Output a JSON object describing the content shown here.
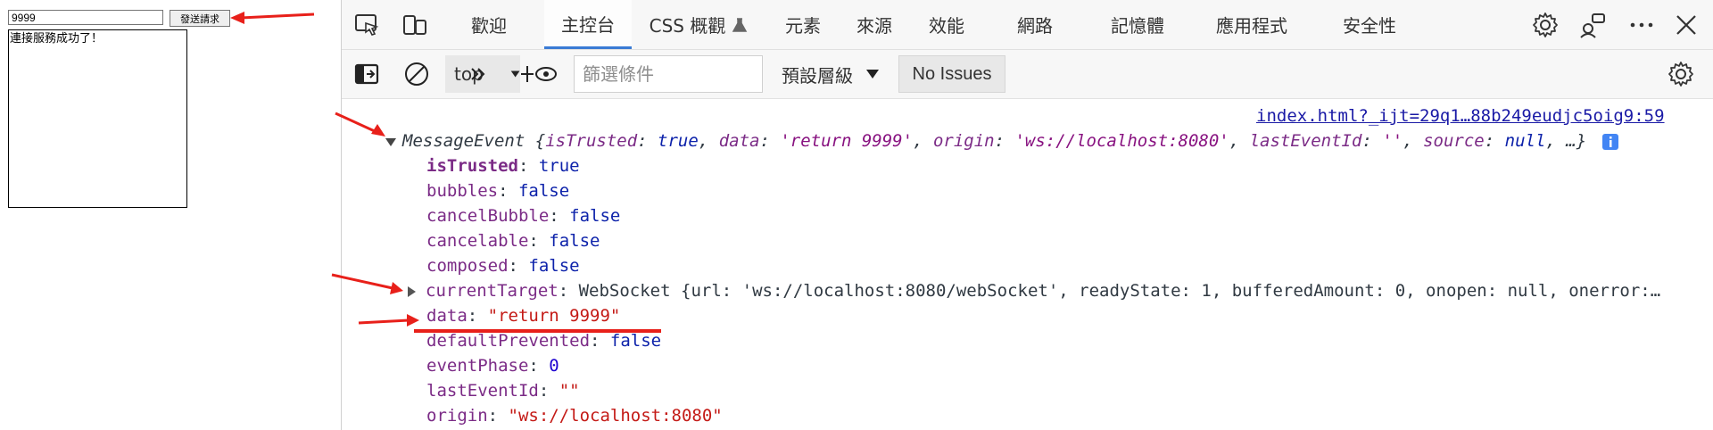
{
  "page": {
    "input_value": "9999",
    "send_label": "發送請求",
    "output_text": "連接服務成功了！"
  },
  "devtools": {
    "tabs": [
      {
        "label": "歡迎"
      },
      {
        "label": "主控台",
        "active": true
      },
      {
        "label": "CSS 概觀"
      },
      {
        "label": "元素"
      },
      {
        "label": "來源"
      },
      {
        "label": "效能"
      },
      {
        "label": "網路"
      },
      {
        "label": "記憶體"
      },
      {
        "label": "應用程式"
      },
      {
        "label": "安全性"
      }
    ],
    "icons": [
      "inspect-icon",
      "device-emulation-icon",
      "flask-icon",
      "settings-icon",
      "feedback-icon",
      "more-icon",
      "close-icon"
    ],
    "toolbar": {
      "context": "top",
      "filter_placeholder": "篩選條件",
      "levels_label": "預設層級",
      "issues_label": "No Issues"
    },
    "accent_color": "#3a7bd5"
  },
  "console": {
    "source": "index.html?_ijt=29q1…88b249eudjc5oig9:59",
    "event_type": "MessageEvent",
    "summary_open": "{",
    "summary_pairs": [
      {
        "key": "isTrusted",
        "val": "true",
        "kind": "bool"
      },
      {
        "key": "data",
        "val": "'return 9999'",
        "kind": "strp"
      },
      {
        "key": "origin",
        "val": "'ws://localhost:8080'",
        "kind": "strp"
      },
      {
        "key": "lastEventId",
        "val": "''",
        "kind": "strp"
      },
      {
        "key": "source",
        "val": "null",
        "kind": "bool"
      }
    ],
    "summary_close": ", …}",
    "props": [
      {
        "key": "isTrusted",
        "val": "true",
        "kind": "bool",
        "bold": true
      },
      {
        "key": "bubbles",
        "val": "false",
        "kind": "bool"
      },
      {
        "key": "cancelBubble",
        "val": "false",
        "kind": "bool"
      },
      {
        "key": "cancelable",
        "val": "false",
        "kind": "bool"
      },
      {
        "key": "composed",
        "val": "false",
        "kind": "bool"
      },
      {
        "key": "currentTarget",
        "val": "WebSocket",
        "kind": "obj",
        "expandable": true,
        "rest": "{url: 'ws://localhost:8080/webSocket', readyState: 1, bufferedAmount: 0, onopen: null, onerror:…"
      },
      {
        "key": "data",
        "val": "\"return 9999\"",
        "kind": "str"
      },
      {
        "key": "defaultPrevented",
        "val": "false",
        "kind": "bool"
      },
      {
        "key": "eventPhase",
        "val": "0",
        "kind": "num"
      },
      {
        "key": "lastEventId",
        "val": "\"\"",
        "kind": "str"
      },
      {
        "key": "origin",
        "val": "\"ws://localhost:8080\"",
        "kind": "str"
      }
    ]
  },
  "annotation_color": "#e8201a"
}
